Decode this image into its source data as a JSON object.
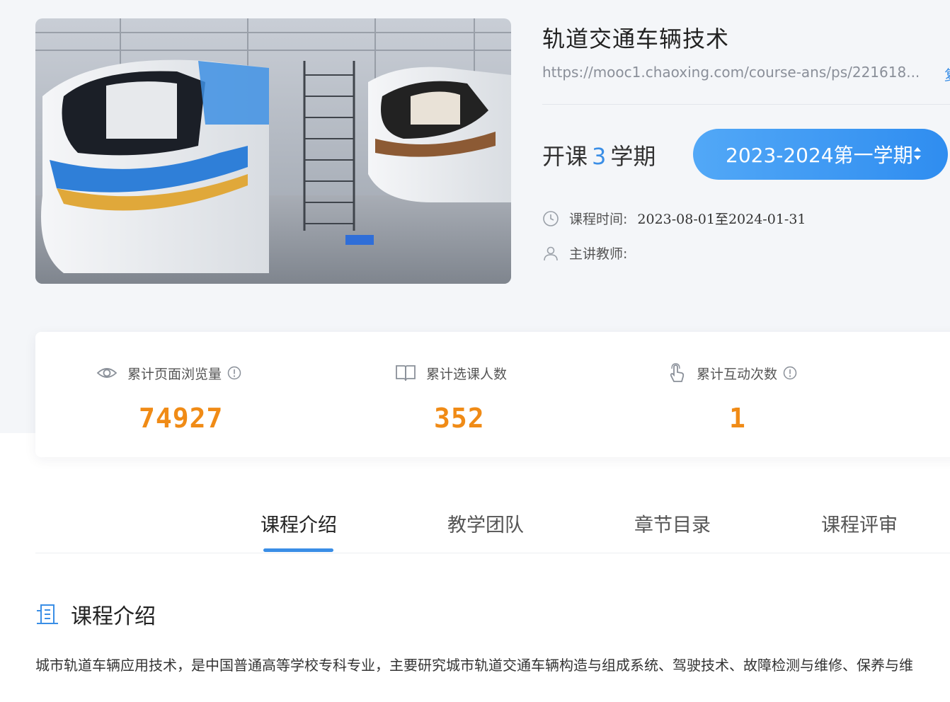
{
  "course": {
    "title": "轨道交通车辆技术",
    "url": "https://mooc1.chaoxing.com/course-ans/ps/221618...",
    "copy_label": "复",
    "terms_prefix": "开课",
    "terms_count": "3",
    "terms_suffix": "学期",
    "semester_selected": "2023-2024第一学期",
    "time_label": "课程时间:",
    "time_value": "2023-08-01至2024-01-31",
    "teacher_label": "主讲教师:",
    "teacher_value": ""
  },
  "stats": [
    {
      "label": "累计页面浏览量",
      "value": "74927",
      "icon": "eye-icon",
      "has_info": true
    },
    {
      "label": "累计选课人数",
      "value": "352",
      "icon": "book-icon",
      "has_info": false
    },
    {
      "label": "累计互动次数",
      "value": "1",
      "icon": "hand-pointer-icon",
      "has_info": true
    }
  ],
  "tabs": [
    {
      "label": "课程介绍",
      "active": true
    },
    {
      "label": "教学团队",
      "active": false
    },
    {
      "label": "章节目录",
      "active": false
    },
    {
      "label": "课程评审",
      "active": false
    }
  ],
  "section": {
    "title": "课程介绍",
    "text": "城市轨道车辆应用技术，是中国普通高等学校专科专业，主要研究城市轨道交通车辆构造与组成系统、驾驶技术、故障检测与维修、保养与维"
  },
  "colors": {
    "accent": "#3a8ee6",
    "stat_number": "#f08b16",
    "background": "#f4f6f9"
  }
}
